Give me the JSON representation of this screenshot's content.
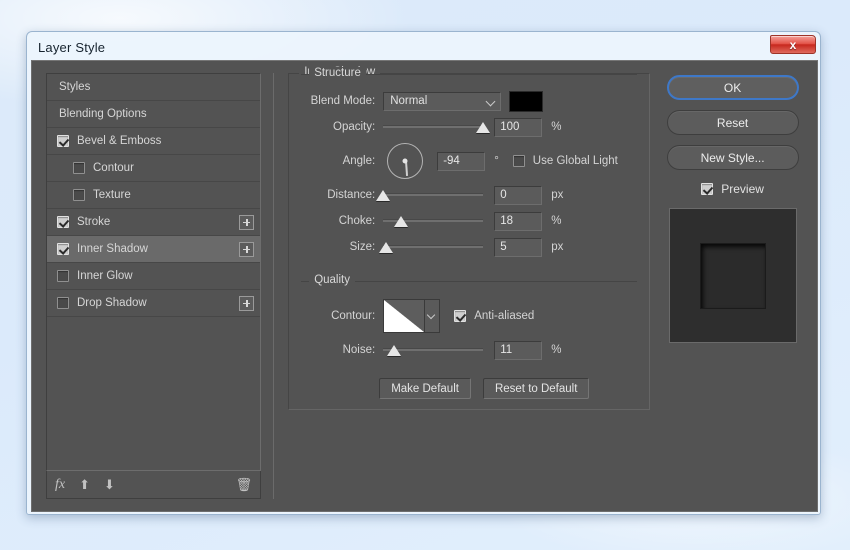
{
  "window": {
    "title": "Layer Style",
    "close_label": "x"
  },
  "styles_panel": {
    "items": [
      {
        "label": "Styles",
        "checkbox": "none",
        "indent": false,
        "plus": false,
        "selected": false
      },
      {
        "label": "Blending Options",
        "checkbox": "none",
        "indent": false,
        "plus": false,
        "selected": false
      },
      {
        "label": "Bevel & Emboss",
        "checkbox": "checked",
        "indent": false,
        "plus": false,
        "selected": false
      },
      {
        "label": "Contour",
        "checkbox": "empty",
        "indent": true,
        "plus": false,
        "selected": false
      },
      {
        "label": "Texture",
        "checkbox": "empty",
        "indent": true,
        "plus": false,
        "selected": false
      },
      {
        "label": "Stroke",
        "checkbox": "checked",
        "indent": false,
        "plus": true,
        "selected": false
      },
      {
        "label": "Inner Shadow",
        "checkbox": "checked",
        "indent": false,
        "plus": true,
        "selected": true
      },
      {
        "label": "Inner Glow",
        "checkbox": "empty",
        "indent": false,
        "plus": false,
        "selected": false
      },
      {
        "label": "Drop Shadow",
        "checkbox": "empty",
        "indent": false,
        "plus": true,
        "selected": false
      }
    ],
    "toolbar": {
      "fx": "fx",
      "move_up": "⬆",
      "move_down": "⬇",
      "delete": "🗑"
    }
  },
  "effect": {
    "title": "Inner Shadow",
    "structure": {
      "legend": "Structure",
      "blend_mode_label": "Blend Mode:",
      "blend_mode_value": "Normal",
      "color": "#000000",
      "opacity_label": "Opacity:",
      "opacity_value": "100",
      "opacity_unit": "%",
      "opacity_percent": 100,
      "angle_label": "Angle:",
      "angle_value": "-94",
      "angle_unit": "°",
      "angle_degrees": -94,
      "use_global_light_label": "Use Global Light",
      "use_global_light_checked": false,
      "distance_label": "Distance:",
      "distance_value": "0",
      "distance_unit": "px",
      "distance_percent": 0,
      "choke_label": "Choke:",
      "choke_value": "18",
      "choke_unit": "%",
      "choke_percent": 18,
      "size_label": "Size:",
      "size_value": "5",
      "size_unit": "px",
      "size_percent": 3
    },
    "quality": {
      "legend": "Quality",
      "contour_label": "Contour:",
      "anti_aliased_label": "Anti-aliased",
      "anti_aliased_checked": true,
      "noise_label": "Noise:",
      "noise_value": "11",
      "noise_unit": "%",
      "noise_percent": 11
    },
    "defaults": {
      "make_default": "Make Default",
      "reset_to_default": "Reset to Default"
    }
  },
  "actions": {
    "ok": "OK",
    "reset": "Reset",
    "new_style": "New Style...",
    "preview_label": "Preview",
    "preview_checked": true
  }
}
